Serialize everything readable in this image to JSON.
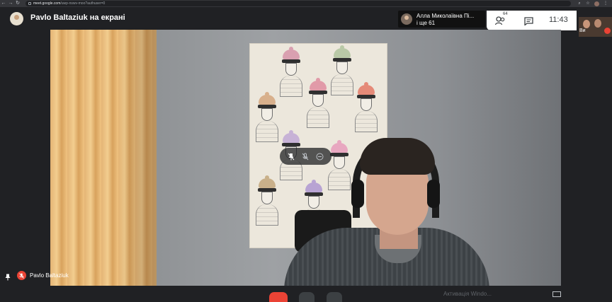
{
  "browser": {
    "url_host": "meet.google.com",
    "url_rest": "/uwp-nswv-moo?authuser=0"
  },
  "meeting": {
    "presenting_title": "Pavlo Baltaziuk на екрані",
    "participant_card": {
      "name": "Алла Миколаївна Пі...",
      "more": "і ще 61"
    },
    "people_count": "64",
    "clock": "11:43",
    "self_tile_label": "Ви"
  },
  "camera_overlay": {
    "buttons": [
      "pin",
      "mute-mic",
      "remove"
    ]
  },
  "bottom_bar": {
    "self_name": "Pavlo Baltaziuk",
    "watermark": "Активація Windo..."
  },
  "colors": {
    "background": "#202124",
    "mic_off_red": "#ea4335",
    "panel_white": "#ffffff"
  }
}
